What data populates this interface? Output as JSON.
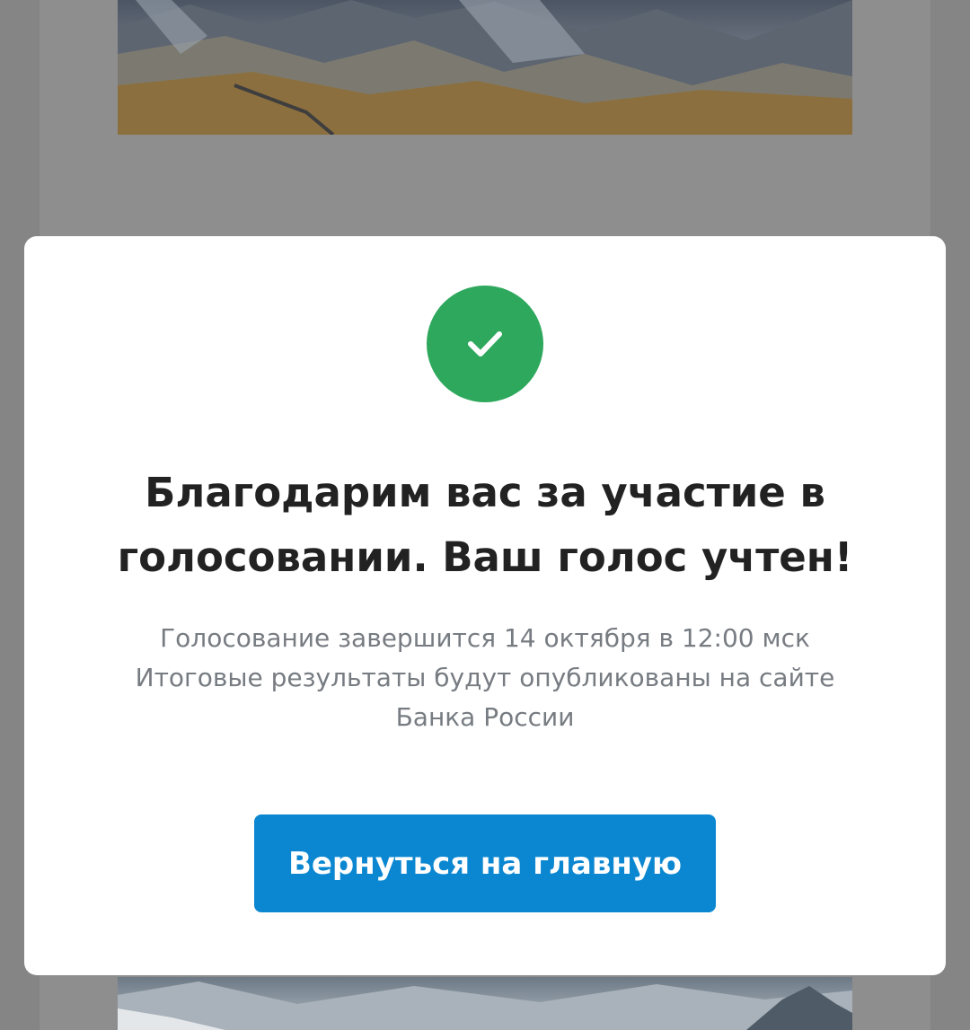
{
  "modal": {
    "icon": "checkmark-icon",
    "title_line1": "Благодарим вас за участие в",
    "title_line2": "голосовании. Ваш голос учтен!",
    "subtitle_line1": "Голосование завершится 14 октября в 12:00 мск",
    "subtitle_line2": "Итоговые результаты будут опубликованы на сайте",
    "subtitle_line3": "Банка России",
    "button_label": "Вернуться на главную"
  },
  "colors": {
    "success": "#2ea85c",
    "primary_button": "#0b87d1",
    "title_text": "#222222",
    "subtitle_text": "#777c82",
    "backdrop": "#858585"
  }
}
